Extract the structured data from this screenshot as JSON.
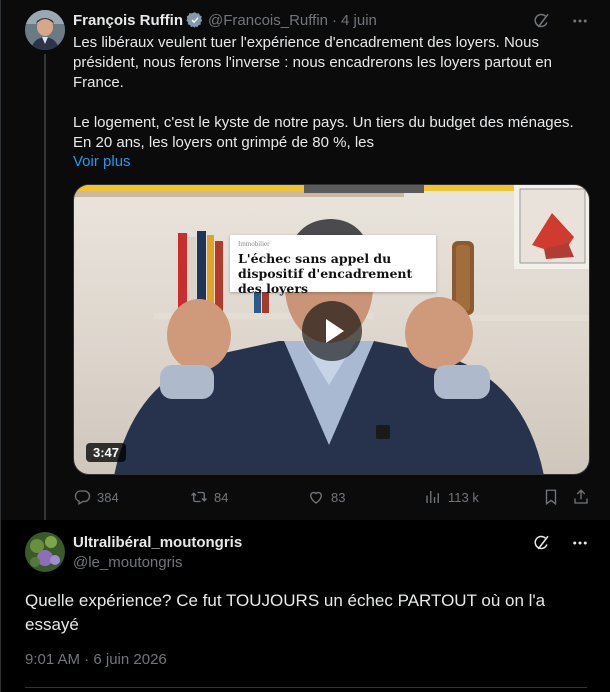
{
  "tweet": {
    "author_name": "François Ruffin",
    "handle": "@Francois_Ruffin",
    "date": "4 juin",
    "text_para1": "Les libéraux veulent tuer l'expérience d'encadrement des loyers. Nous président, nous ferons l'inverse : nous encadrerons les loyers partout en France.",
    "text_para2": "Le logement, c'est le kyste de notre pays. Un tiers du budget des ménages. En 20 ans, les loyers ont grimpé de 80 %, les",
    "show_more": "Voir plus",
    "video": {
      "duration": "3:47",
      "overlay_category": "Immobilier",
      "overlay_title": "L'échec sans appel du dispositif d'encadrement des loyers"
    },
    "metrics": {
      "replies": "384",
      "reposts": "84",
      "likes": "83",
      "views": "113 k"
    }
  },
  "reply": {
    "author_name": "Ultralibéral_moutongris",
    "handle": "@le_moutongris",
    "text": "Quelle expérience? Ce fut TOUJOURS un échec PARTOUT où on l'a essayé",
    "timestamp": "9:01 AM · 6 juin 2026"
  },
  "colors": {
    "accent": "#1d9bf0",
    "muted": "#71767b",
    "text": "#e7e9ea",
    "background": "#000000"
  },
  "icons": [
    "verified-badge-icon",
    "grok-icon",
    "more-icon",
    "reply-icon",
    "repost-icon",
    "like-icon",
    "views-icon",
    "bookmark-icon",
    "share-icon",
    "play-icon"
  ]
}
